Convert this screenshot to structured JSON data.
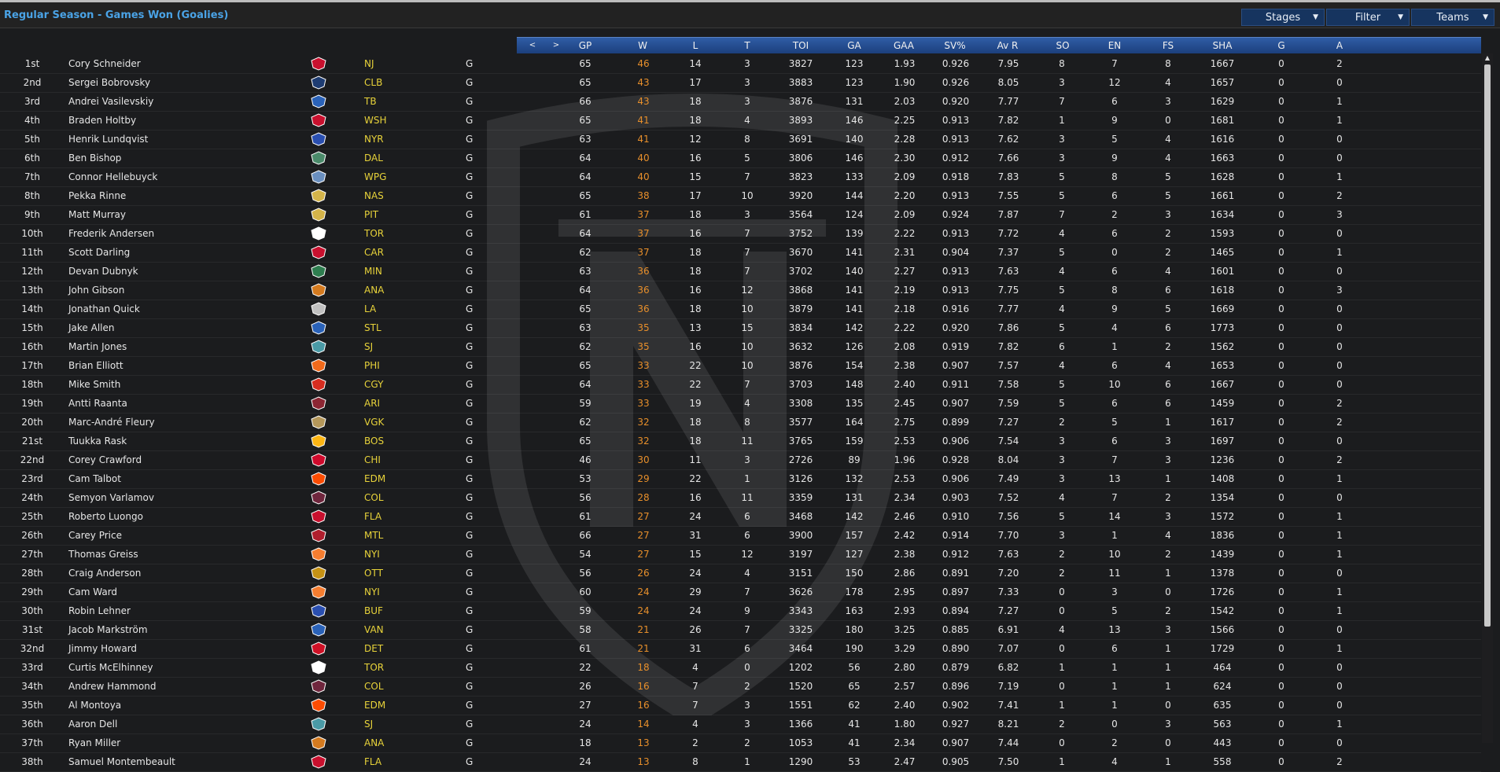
{
  "title": "Regular Season - Games Won (Goalies)",
  "menus": [
    {
      "label": "Stages"
    },
    {
      "label": "Filter"
    },
    {
      "label": "Teams"
    }
  ],
  "nav": {
    "prev": "<",
    "next": ">"
  },
  "columns": [
    "GP",
    "W",
    "L",
    "T",
    "TOI",
    "GA",
    "GAA",
    "SV%",
    "Av R",
    "SO",
    "EN",
    "FS",
    "SHA",
    "G",
    "A"
  ],
  "colors": {
    "accent": "#4aa3e6",
    "team": "#e7d23a",
    "wins": "#e78f2b",
    "header": "#2a55a0"
  },
  "players": [
    {
      "rank": "1st",
      "name": "Cory Schneider",
      "team": "NJ",
      "icon": "devils-logo-icon",
      "pos": "G",
      "stats": [
        "65",
        "46",
        "14",
        "3",
        "3827",
        "123",
        "1.93",
        "0.926",
        "7.95",
        "8",
        "7",
        "8",
        "1667",
        "0",
        "2"
      ]
    },
    {
      "rank": "2nd",
      "name": "Sergei Bobrovsky",
      "team": "CLB",
      "icon": "blue-jackets-logo-icon",
      "pos": "G",
      "stats": [
        "65",
        "43",
        "17",
        "3",
        "3883",
        "123",
        "1.90",
        "0.926",
        "8.05",
        "3",
        "12",
        "4",
        "1657",
        "0",
        "0"
      ]
    },
    {
      "rank": "3rd",
      "name": "Andrei Vasilevskiy",
      "team": "TB",
      "icon": "lightning-logo-icon",
      "pos": "G",
      "stats": [
        "66",
        "43",
        "18",
        "3",
        "3876",
        "131",
        "2.03",
        "0.920",
        "7.77",
        "7",
        "6",
        "3",
        "1629",
        "0",
        "1"
      ]
    },
    {
      "rank": "4th",
      "name": "Braden Holtby",
      "team": "WSH",
      "icon": "capitals-logo-icon",
      "pos": "G",
      "stats": [
        "65",
        "41",
        "18",
        "4",
        "3893",
        "146",
        "2.25",
        "0.913",
        "7.82",
        "1",
        "9",
        "0",
        "1681",
        "0",
        "1"
      ]
    },
    {
      "rank": "5th",
      "name": "Henrik Lundqvist",
      "team": "NYR",
      "icon": "rangers-logo-icon",
      "pos": "G",
      "stats": [
        "63",
        "41",
        "12",
        "8",
        "3691",
        "140",
        "2.28",
        "0.913",
        "7.62",
        "3",
        "5",
        "4",
        "1616",
        "0",
        "0"
      ]
    },
    {
      "rank": "6th",
      "name": "Ben Bishop",
      "team": "DAL",
      "icon": "stars-logo-icon",
      "pos": "G",
      "stats": [
        "64",
        "40",
        "16",
        "5",
        "3806",
        "146",
        "2.30",
        "0.912",
        "7.66",
        "3",
        "9",
        "4",
        "1663",
        "0",
        "0"
      ]
    },
    {
      "rank": "7th",
      "name": "Connor Hellebuyck",
      "team": "WPG",
      "icon": "jets-logo-icon",
      "pos": "G",
      "stats": [
        "64",
        "40",
        "15",
        "7",
        "3823",
        "133",
        "2.09",
        "0.918",
        "7.83",
        "5",
        "8",
        "5",
        "1628",
        "0",
        "1"
      ]
    },
    {
      "rank": "8th",
      "name": "Pekka Rinne",
      "team": "NAS",
      "icon": "predators-logo-icon",
      "pos": "G",
      "stats": [
        "65",
        "38",
        "17",
        "10",
        "3920",
        "144",
        "2.20",
        "0.913",
        "7.55",
        "5",
        "6",
        "5",
        "1661",
        "0",
        "2"
      ]
    },
    {
      "rank": "9th",
      "name": "Matt Murray",
      "team": "PIT",
      "icon": "penguins-logo-icon",
      "pos": "G",
      "stats": [
        "61",
        "37",
        "18",
        "3",
        "3564",
        "124",
        "2.09",
        "0.924",
        "7.87",
        "7",
        "2",
        "3",
        "1634",
        "0",
        "3"
      ]
    },
    {
      "rank": "10th",
      "name": "Frederik Andersen",
      "team": "TOR",
      "icon": "maple-leafs-logo-icon",
      "pos": "G",
      "stats": [
        "64",
        "37",
        "16",
        "7",
        "3752",
        "139",
        "2.22",
        "0.913",
        "7.72",
        "4",
        "6",
        "2",
        "1593",
        "0",
        "0"
      ]
    },
    {
      "rank": "11th",
      "name": "Scott Darling",
      "team": "CAR",
      "icon": "hurricanes-logo-icon",
      "pos": "G",
      "stats": [
        "62",
        "37",
        "18",
        "7",
        "3670",
        "141",
        "2.31",
        "0.904",
        "7.37",
        "5",
        "0",
        "2",
        "1465",
        "0",
        "1"
      ]
    },
    {
      "rank": "12th",
      "name": "Devan Dubnyk",
      "team": "MIN",
      "icon": "wild-logo-icon",
      "pos": "G",
      "stats": [
        "63",
        "36",
        "18",
        "7",
        "3702",
        "140",
        "2.27",
        "0.913",
        "7.63",
        "4",
        "6",
        "4",
        "1601",
        "0",
        "0"
      ]
    },
    {
      "rank": "13th",
      "name": "John Gibson",
      "team": "ANA",
      "icon": "ducks-logo-icon",
      "pos": "G",
      "stats": [
        "64",
        "36",
        "16",
        "12",
        "3868",
        "141",
        "2.19",
        "0.913",
        "7.75",
        "5",
        "8",
        "6",
        "1618",
        "0",
        "3"
      ]
    },
    {
      "rank": "14th",
      "name": "Jonathan Quick",
      "team": "LA",
      "icon": "kings-logo-icon",
      "pos": "G",
      "stats": [
        "65",
        "36",
        "18",
        "10",
        "3879",
        "141",
        "2.18",
        "0.916",
        "7.77",
        "4",
        "9",
        "5",
        "1669",
        "0",
        "0"
      ]
    },
    {
      "rank": "15th",
      "name": "Jake Allen",
      "team": "STL",
      "icon": "blues-logo-icon",
      "pos": "G",
      "stats": [
        "63",
        "35",
        "13",
        "15",
        "3834",
        "142",
        "2.22",
        "0.920",
        "7.86",
        "5",
        "4",
        "6",
        "1773",
        "0",
        "0"
      ]
    },
    {
      "rank": "16th",
      "name": "Martin Jones",
      "team": "SJ",
      "icon": "sharks-logo-icon",
      "pos": "G",
      "stats": [
        "62",
        "35",
        "16",
        "10",
        "3632",
        "126",
        "2.08",
        "0.919",
        "7.82",
        "6",
        "1",
        "2",
        "1562",
        "0",
        "0"
      ]
    },
    {
      "rank": "17th",
      "name": "Brian Elliott",
      "team": "PHI",
      "icon": "flyers-logo-icon",
      "pos": "G",
      "stats": [
        "65",
        "33",
        "22",
        "10",
        "3876",
        "154",
        "2.38",
        "0.907",
        "7.57",
        "4",
        "6",
        "4",
        "1653",
        "0",
        "0"
      ]
    },
    {
      "rank": "18th",
      "name": "Mike Smith",
      "team": "CGY",
      "icon": "flames-logo-icon",
      "pos": "G",
      "stats": [
        "64",
        "33",
        "22",
        "7",
        "3703",
        "148",
        "2.40",
        "0.911",
        "7.58",
        "5",
        "10",
        "6",
        "1667",
        "0",
        "0"
      ]
    },
    {
      "rank": "19th",
      "name": "Antti Raanta",
      "team": "ARI",
      "icon": "coyotes-logo-icon",
      "pos": "G",
      "stats": [
        "59",
        "33",
        "19",
        "4",
        "3308",
        "135",
        "2.45",
        "0.907",
        "7.59",
        "5",
        "6",
        "6",
        "1459",
        "0",
        "2"
      ]
    },
    {
      "rank": "20th",
      "name": "Marc-André Fleury",
      "team": "VGK",
      "icon": "golden-knights-logo-icon",
      "pos": "G",
      "stats": [
        "62",
        "32",
        "18",
        "8",
        "3577",
        "164",
        "2.75",
        "0.899",
        "7.27",
        "2",
        "5",
        "1",
        "1617",
        "0",
        "2"
      ]
    },
    {
      "rank": "21st",
      "name": "Tuukka Rask",
      "team": "BOS",
      "icon": "bruins-logo-icon",
      "pos": "G",
      "stats": [
        "65",
        "32",
        "18",
        "11",
        "3765",
        "159",
        "2.53",
        "0.906",
        "7.54",
        "3",
        "6",
        "3",
        "1697",
        "0",
        "0"
      ]
    },
    {
      "rank": "22nd",
      "name": "Corey Crawford",
      "team": "CHI",
      "icon": "blackhawks-logo-icon",
      "pos": "G",
      "stats": [
        "46",
        "30",
        "11",
        "3",
        "2726",
        "89",
        "1.96",
        "0.928",
        "8.04",
        "3",
        "7",
        "3",
        "1236",
        "0",
        "2"
      ]
    },
    {
      "rank": "23rd",
      "name": "Cam Talbot",
      "team": "EDM",
      "icon": "oilers-logo-icon",
      "pos": "G",
      "stats": [
        "53",
        "29",
        "22",
        "1",
        "3126",
        "132",
        "2.53",
        "0.906",
        "7.49",
        "3",
        "13",
        "1",
        "1408",
        "0",
        "1"
      ]
    },
    {
      "rank": "24th",
      "name": "Semyon Varlamov",
      "team": "COL",
      "icon": "avalanche-logo-icon",
      "pos": "G",
      "stats": [
        "56",
        "28",
        "16",
        "11",
        "3359",
        "131",
        "2.34",
        "0.903",
        "7.52",
        "4",
        "7",
        "2",
        "1354",
        "0",
        "0"
      ]
    },
    {
      "rank": "25th",
      "name": "Roberto Luongo",
      "team": "FLA",
      "icon": "panthers-logo-icon",
      "pos": "G",
      "stats": [
        "61",
        "27",
        "24",
        "6",
        "3468",
        "142",
        "2.46",
        "0.910",
        "7.56",
        "5",
        "14",
        "3",
        "1572",
        "0",
        "1"
      ]
    },
    {
      "rank": "26th",
      "name": "Carey Price",
      "team": "MTL",
      "icon": "canadiens-logo-icon",
      "pos": "G",
      "stats": [
        "66",
        "27",
        "31",
        "6",
        "3900",
        "157",
        "2.42",
        "0.914",
        "7.70",
        "3",
        "1",
        "4",
        "1836",
        "0",
        "1"
      ]
    },
    {
      "rank": "27th",
      "name": "Thomas Greiss",
      "team": "NYI",
      "icon": "islanders-logo-icon",
      "pos": "G",
      "stats": [
        "54",
        "27",
        "15",
        "12",
        "3197",
        "127",
        "2.38",
        "0.912",
        "7.63",
        "2",
        "10",
        "2",
        "1439",
        "0",
        "1"
      ]
    },
    {
      "rank": "28th",
      "name": "Craig Anderson",
      "team": "OTT",
      "icon": "senators-logo-icon",
      "pos": "G",
      "stats": [
        "56",
        "26",
        "24",
        "4",
        "3151",
        "150",
        "2.86",
        "0.891",
        "7.20",
        "2",
        "11",
        "1",
        "1378",
        "0",
        "0"
      ]
    },
    {
      "rank": "29th",
      "name": "Cam Ward",
      "team": "NYI",
      "icon": "islanders-logo-icon",
      "pos": "G",
      "stats": [
        "60",
        "24",
        "29",
        "7",
        "3626",
        "178",
        "2.95",
        "0.897",
        "7.33",
        "0",
        "3",
        "0",
        "1726",
        "0",
        "1"
      ]
    },
    {
      "rank": "30th",
      "name": "Robin Lehner",
      "team": "BUF",
      "icon": "sabres-logo-icon",
      "pos": "G",
      "stats": [
        "59",
        "24",
        "24",
        "9",
        "3343",
        "163",
        "2.93",
        "0.894",
        "7.27",
        "0",
        "5",
        "2",
        "1542",
        "0",
        "1"
      ]
    },
    {
      "rank": "31st",
      "name": "Jacob Markström",
      "team": "VAN",
      "icon": "canucks-logo-icon",
      "pos": "G",
      "stats": [
        "58",
        "21",
        "26",
        "7",
        "3325",
        "180",
        "3.25",
        "0.885",
        "6.91",
        "4",
        "13",
        "3",
        "1566",
        "0",
        "0"
      ]
    },
    {
      "rank": "32nd",
      "name": "Jimmy Howard",
      "team": "DET",
      "icon": "red-wings-logo-icon",
      "pos": "G",
      "stats": [
        "61",
        "21",
        "31",
        "6",
        "3464",
        "190",
        "3.29",
        "0.890",
        "7.07",
        "0",
        "6",
        "1",
        "1729",
        "0",
        "1"
      ]
    },
    {
      "rank": "33rd",
      "name": "Curtis McElhinney",
      "team": "TOR",
      "icon": "maple-leafs-logo-icon",
      "pos": "G",
      "stats": [
        "22",
        "18",
        "4",
        "0",
        "1202",
        "56",
        "2.80",
        "0.879",
        "6.82",
        "1",
        "1",
        "1",
        "464",
        "0",
        "0"
      ]
    },
    {
      "rank": "34th",
      "name": "Andrew Hammond",
      "team": "COL",
      "icon": "avalanche-logo-icon",
      "pos": "G",
      "stats": [
        "26",
        "16",
        "7",
        "2",
        "1520",
        "65",
        "2.57",
        "0.896",
        "7.19",
        "0",
        "1",
        "1",
        "624",
        "0",
        "0"
      ]
    },
    {
      "rank": "35th",
      "name": "Al Montoya",
      "team": "EDM",
      "icon": "oilers-logo-icon",
      "pos": "G",
      "stats": [
        "27",
        "16",
        "7",
        "3",
        "1551",
        "62",
        "2.40",
        "0.902",
        "7.41",
        "1",
        "1",
        "0",
        "635",
        "0",
        "0"
      ]
    },
    {
      "rank": "36th",
      "name": "Aaron Dell",
      "team": "SJ",
      "icon": "sharks-logo-icon",
      "pos": "G",
      "stats": [
        "24",
        "14",
        "4",
        "3",
        "1366",
        "41",
        "1.80",
        "0.927",
        "8.21",
        "2",
        "0",
        "3",
        "563",
        "0",
        "1"
      ]
    },
    {
      "rank": "37th",
      "name": "Ryan Miller",
      "team": "ANA",
      "icon": "ducks-logo-icon",
      "pos": "G",
      "stats": [
        "18",
        "13",
        "2",
        "2",
        "1053",
        "41",
        "2.34",
        "0.907",
        "7.44",
        "0",
        "2",
        "0",
        "443",
        "0",
        "0"
      ]
    },
    {
      "rank": "38th",
      "name": "Samuel Montembeault",
      "team": "FLA",
      "icon": "panthers-logo-icon",
      "pos": "G",
      "stats": [
        "24",
        "13",
        "8",
        "1",
        "1290",
        "53",
        "2.47",
        "0.905",
        "7.50",
        "1",
        "4",
        "1",
        "558",
        "0",
        "2"
      ]
    }
  ]
}
